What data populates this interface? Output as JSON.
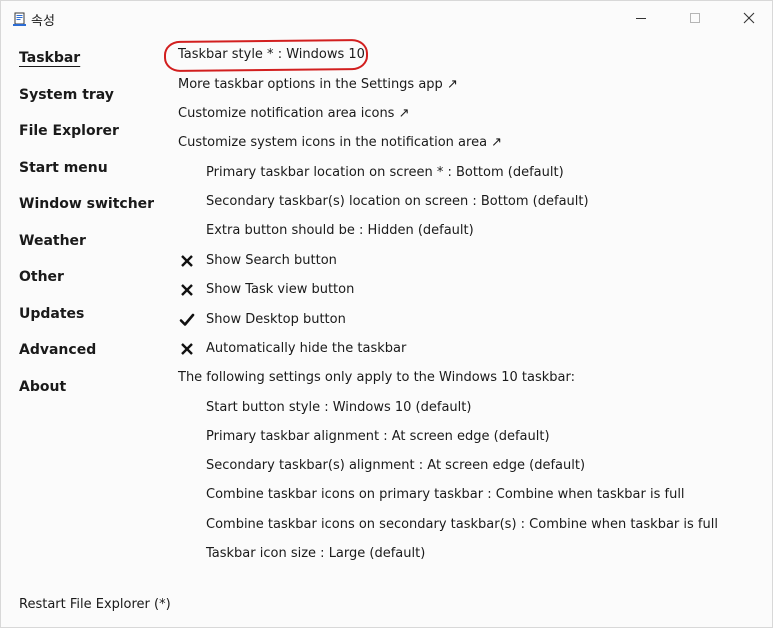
{
  "window": {
    "title": "속성",
    "minimize_glyph": "—",
    "maximize_glyph": "☐",
    "close_glyph": "✕"
  },
  "sidebar": {
    "items": [
      {
        "label": "Taskbar",
        "active": true
      },
      {
        "label": "System tray",
        "active": false
      },
      {
        "label": "File Explorer",
        "active": false
      },
      {
        "label": "Start menu",
        "active": false
      },
      {
        "label": "Window switcher",
        "active": false
      },
      {
        "label": "Weather",
        "active": false
      },
      {
        "label": "Other",
        "active": false
      },
      {
        "label": "Updates",
        "active": false
      },
      {
        "label": "Advanced",
        "active": false
      },
      {
        "label": "About",
        "active": false
      }
    ],
    "restart_label": "Restart File Explorer (*)"
  },
  "settings": {
    "taskbar_style": "Taskbar style * : Windows 10",
    "more_options": "More taskbar options in the Settings app ↗",
    "notif_icons": "Customize notification area icons ↗",
    "system_icons": "Customize system icons in the notification area ↗",
    "primary_location": "Primary taskbar location on screen * : Bottom (default)",
    "secondary_location": "Secondary taskbar(s) location on screen : Bottom (default)",
    "extra_button": "Extra button should be : Hidden (default)",
    "show_search": {
      "label": "Show Search button",
      "checked": false
    },
    "show_taskview": {
      "label": "Show Task view button",
      "checked": false
    },
    "show_desktop": {
      "label": "Show Desktop button",
      "checked": true
    },
    "auto_hide": {
      "label": "Automatically hide the taskbar",
      "checked": false
    },
    "win10_header": "The following settings only apply to the Windows 10 taskbar:",
    "start_button_style": "Start button style : Windows 10 (default)",
    "primary_alignment": "Primary taskbar alignment : At screen edge (default)",
    "secondary_alignment": "Secondary taskbar(s) alignment : At screen edge (default)",
    "combine_primary": "Combine taskbar icons on primary taskbar : Combine when taskbar is full",
    "combine_secondary": "Combine taskbar icons on secondary taskbar(s) : Combine when taskbar is full",
    "icon_size": "Taskbar icon size : Large (default)"
  },
  "colors": {
    "annotation_ring": "#d21f1f",
    "text": "#1a1a1a",
    "background": "#fbfbfb"
  },
  "icons": {
    "check": "check-icon",
    "cross": "cross-icon"
  }
}
